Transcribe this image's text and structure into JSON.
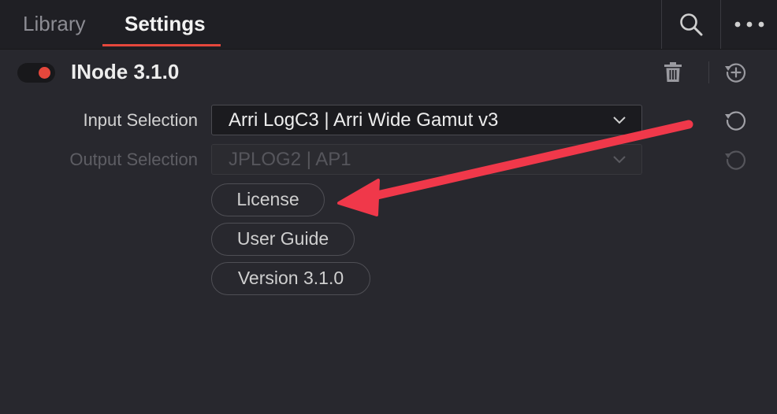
{
  "tabs": [
    {
      "label": "Library",
      "active": false
    },
    {
      "label": "Settings",
      "active": true
    }
  ],
  "toolbar": {
    "search_icon": "search-icon",
    "more_icon": "more-horizontal-icon"
  },
  "node": {
    "title": "INode 3.1.0",
    "enabled": true,
    "delete_icon": "trash-icon",
    "add_icon": "history-add-icon"
  },
  "input_selection": {
    "label": "Input Selection",
    "value": "Arri LogC3 | Arri Wide Gamut v3",
    "reset_icon": "reset-icon"
  },
  "output_selection": {
    "label": "Output Selection",
    "value": "JPLOG2 | AP1",
    "disabled": true,
    "reset_icon": "reset-icon"
  },
  "buttons": {
    "license": "License",
    "user_guide": "User Guide",
    "version": "Version 3.1.0"
  },
  "colors": {
    "accent": "#e5473c",
    "annotation_arrow": "#f0384a",
    "background": "#28282e",
    "tabbar": "#1f1f24"
  }
}
